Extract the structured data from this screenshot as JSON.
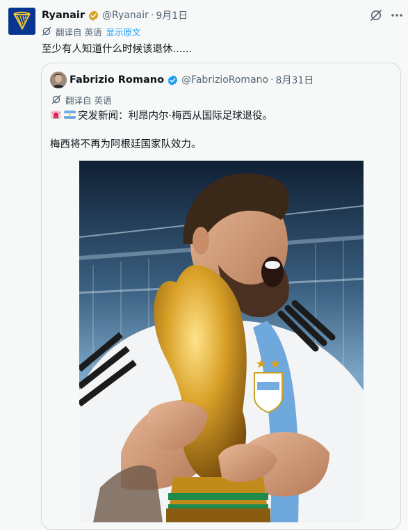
{
  "tweet": {
    "author_name": "Ryanair",
    "author_handle": "@Ryanair",
    "date": "9月1日",
    "separator": "·",
    "translated_label": "翻译自 英语",
    "show_original": "显示原文",
    "text": "至少有人知道什么时候该退休......"
  },
  "quote": {
    "author_name": "Fabrizio Romano",
    "author_handle": "@FabrizioRomano",
    "date": "8月31日",
    "separator": "·",
    "translated_label": "翻译自 英语",
    "line1": "突发新闻：利昂内尔·梅西从国际足球退役。",
    "line2": "梅西将不再为阿根廷国家队效力。",
    "photo_alt": "Messi holding the World Cup trophy"
  },
  "colors": {
    "text": "#0f1419",
    "secondary": "#536471",
    "link": "#1d9bf0",
    "border": "#cfd9de",
    "brand_ryanair": "#073590",
    "gold": "#d8a21f"
  },
  "icons": {
    "verified": "verified-badge-icon",
    "grok": "grok-icon",
    "more": "more-icon",
    "translate": "translate-icon"
  }
}
